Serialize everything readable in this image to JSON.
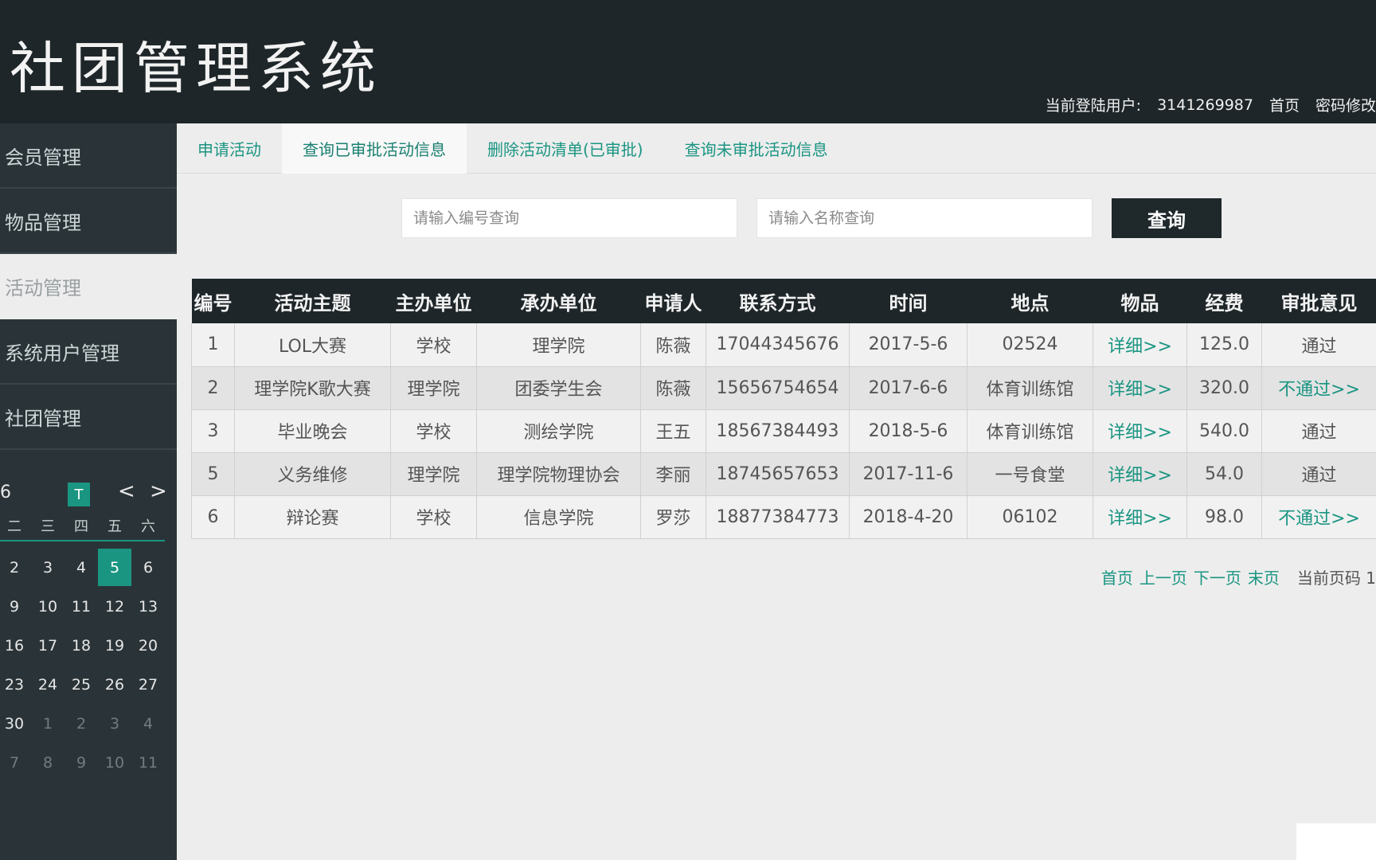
{
  "header": {
    "title": "社团管理系统",
    "user_label": "当前登陆用户:",
    "user_id": "3141269987",
    "home_link": "首页",
    "password_link": "密码修改"
  },
  "sidebar": {
    "items": [
      {
        "label": "会员管理"
      },
      {
        "label": "物品管理"
      },
      {
        "label": "活动管理"
      },
      {
        "label": "系统用户管理"
      },
      {
        "label": "社团管理"
      }
    ]
  },
  "calendar": {
    "month_partial": "6",
    "today_label": "T",
    "prev_label": "<",
    "next_label": ">",
    "weekdays": [
      "二",
      "三",
      "四",
      "五",
      "六"
    ],
    "days": [
      [
        "2",
        "3",
        "4",
        "5",
        "6"
      ],
      [
        "9",
        "10",
        "11",
        "12",
        "13"
      ],
      [
        "16",
        "17",
        "18",
        "19",
        "20"
      ],
      [
        "23",
        "24",
        "25",
        "26",
        "27"
      ],
      [
        "30",
        "1",
        "2",
        "3",
        "4"
      ],
      [
        "7",
        "8",
        "9",
        "10",
        "11"
      ]
    ],
    "selected_day": "5"
  },
  "tabs": [
    {
      "label": "申请活动"
    },
    {
      "label": "查询已审批活动信息"
    },
    {
      "label": "删除活动清单(已审批)"
    },
    {
      "label": "查询未审批活动信息"
    }
  ],
  "search": {
    "id_placeholder": "请输入编号查询",
    "name_placeholder": "请输入名称查询",
    "button_label": "查询"
  },
  "table": {
    "headers": [
      "编号",
      "活动主题",
      "主办单位",
      "承办单位",
      "申请人",
      "联系方式",
      "时间",
      "地点",
      "物品",
      "经费",
      "审批意见"
    ],
    "rows": [
      [
        "1",
        "LOL大赛",
        "学校",
        "理学院",
        "陈薇",
        "17044345676",
        "2017-5-6",
        "02524",
        "详细>>",
        "125.0",
        "通过"
      ],
      [
        "2",
        "理学院K歌大赛",
        "理学院",
        "团委学生会",
        "陈薇",
        "15656754654",
        "2017-6-6",
        "体育训练馆",
        "详细>>",
        "320.0",
        "不通过>>"
      ],
      [
        "3",
        "毕业晚会",
        "学校",
        "测绘学院",
        "王五",
        "18567384493",
        "2018-5-6",
        "体育训练馆",
        "详细>>",
        "540.0",
        "通过"
      ],
      [
        "5",
        "义务维修",
        "理学院",
        "理学院物理协会",
        "李丽",
        "18745657653",
        "2017-11-6",
        "一号食堂",
        "详细>>",
        "54.0",
        "通过"
      ],
      [
        "6",
        "辩论赛",
        "学校",
        "信息学院",
        "罗莎",
        "18877384773",
        "2018-4-20",
        "06102",
        "详细>>",
        "98.0",
        "不通过>>"
      ]
    ]
  },
  "pager": {
    "first": "首页",
    "prev": "上一页",
    "next": "下一页",
    "last": "末页",
    "current_label": "当前页码 1"
  }
}
